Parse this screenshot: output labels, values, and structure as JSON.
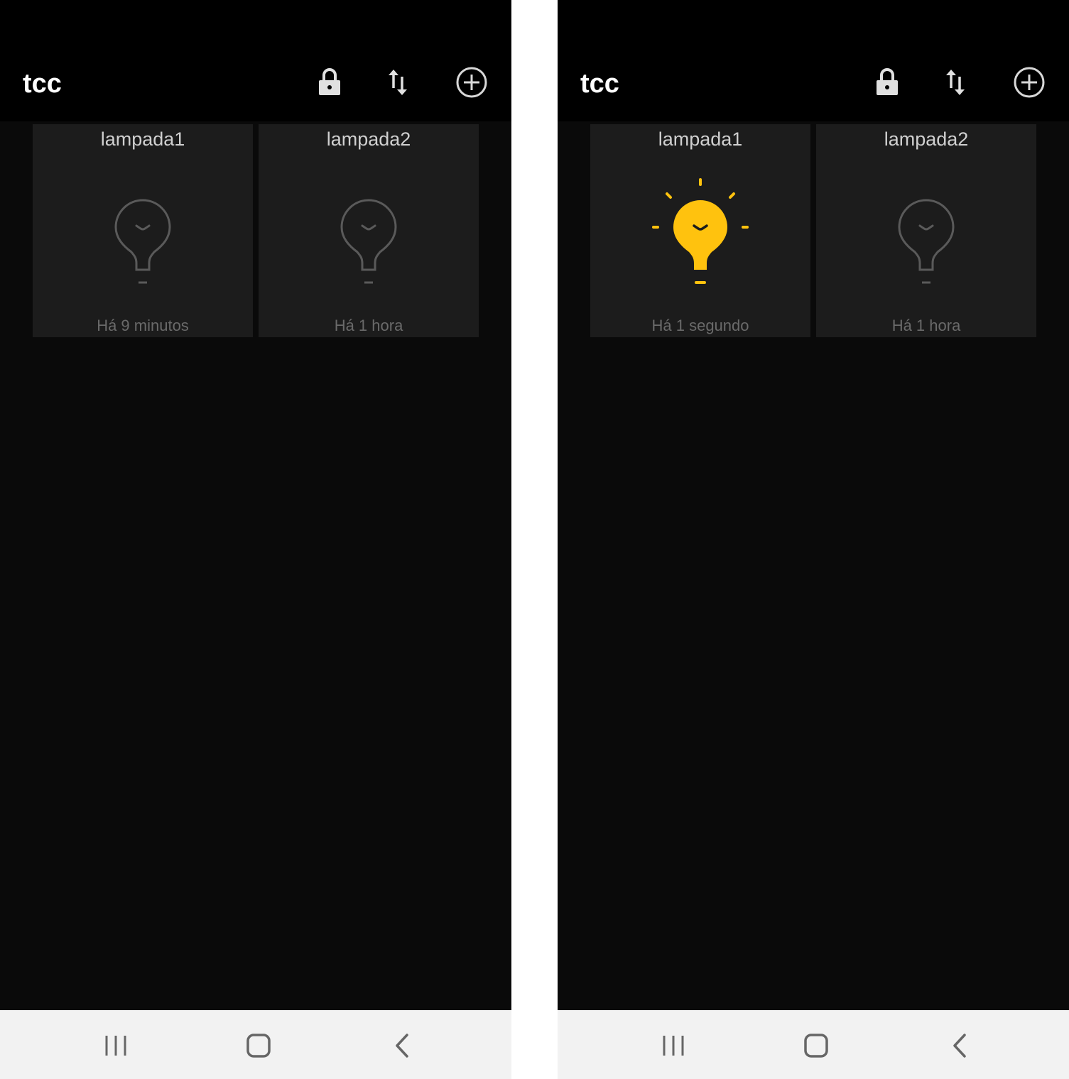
{
  "screens": [
    {
      "app_title": "tcc",
      "tiles": [
        {
          "name": "lampada1",
          "state": "off",
          "time": "Há 9 minutos",
          "icon": "lightbulb-off-icon"
        },
        {
          "name": "lampada2",
          "state": "off",
          "time": "Há 1 hora",
          "icon": "lightbulb-off-icon"
        }
      ]
    },
    {
      "app_title": "tcc",
      "tiles": [
        {
          "name": "lampada1",
          "state": "on",
          "time": "Há 1 segundo",
          "icon": "lightbulb-on-icon"
        },
        {
          "name": "lampada2",
          "state": "off",
          "time": "Há 1 hora",
          "icon": "lightbulb-off-icon"
        }
      ]
    }
  ],
  "header_icons": [
    "lock-icon",
    "sort-icon",
    "add-circle-icon"
  ],
  "navigation_icons": [
    "recent-apps-icon",
    "home-icon",
    "back-icon"
  ],
  "colors": {
    "background": "#0a0a0a",
    "header": "#000000",
    "tile": "#1c1c1c",
    "bulb_on": "#ffc20e",
    "bulb_off_outline": "#5a5a5a",
    "navbar": "#f2f2f2"
  }
}
